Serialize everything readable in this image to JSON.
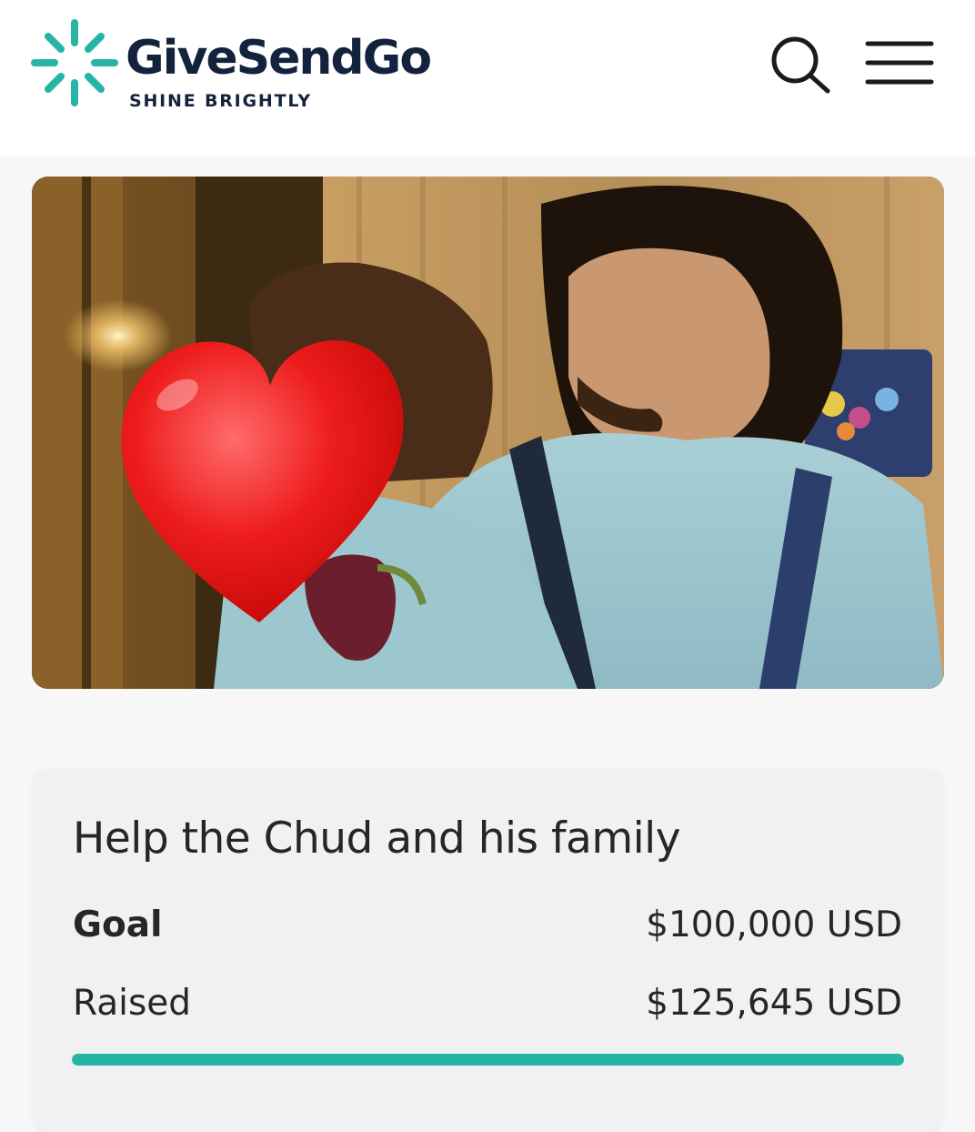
{
  "brand": {
    "name": "GiveSendGo",
    "tagline": "SHINE BRIGHTLY",
    "accent_color": "#26b5a4",
    "text_color": "#13233d"
  },
  "header": {
    "search_icon": "search-icon",
    "menu_icon": "hamburger-menu-icon"
  },
  "hero": {
    "overlay_icon": "red-heart-emoji"
  },
  "campaign": {
    "title": "Help the Chud and his family",
    "goal_label": "Goal",
    "goal_value": "$100,000 USD",
    "raised_label": "Raised",
    "raised_value": "$125,645 USD",
    "progress_percent": 100
  }
}
